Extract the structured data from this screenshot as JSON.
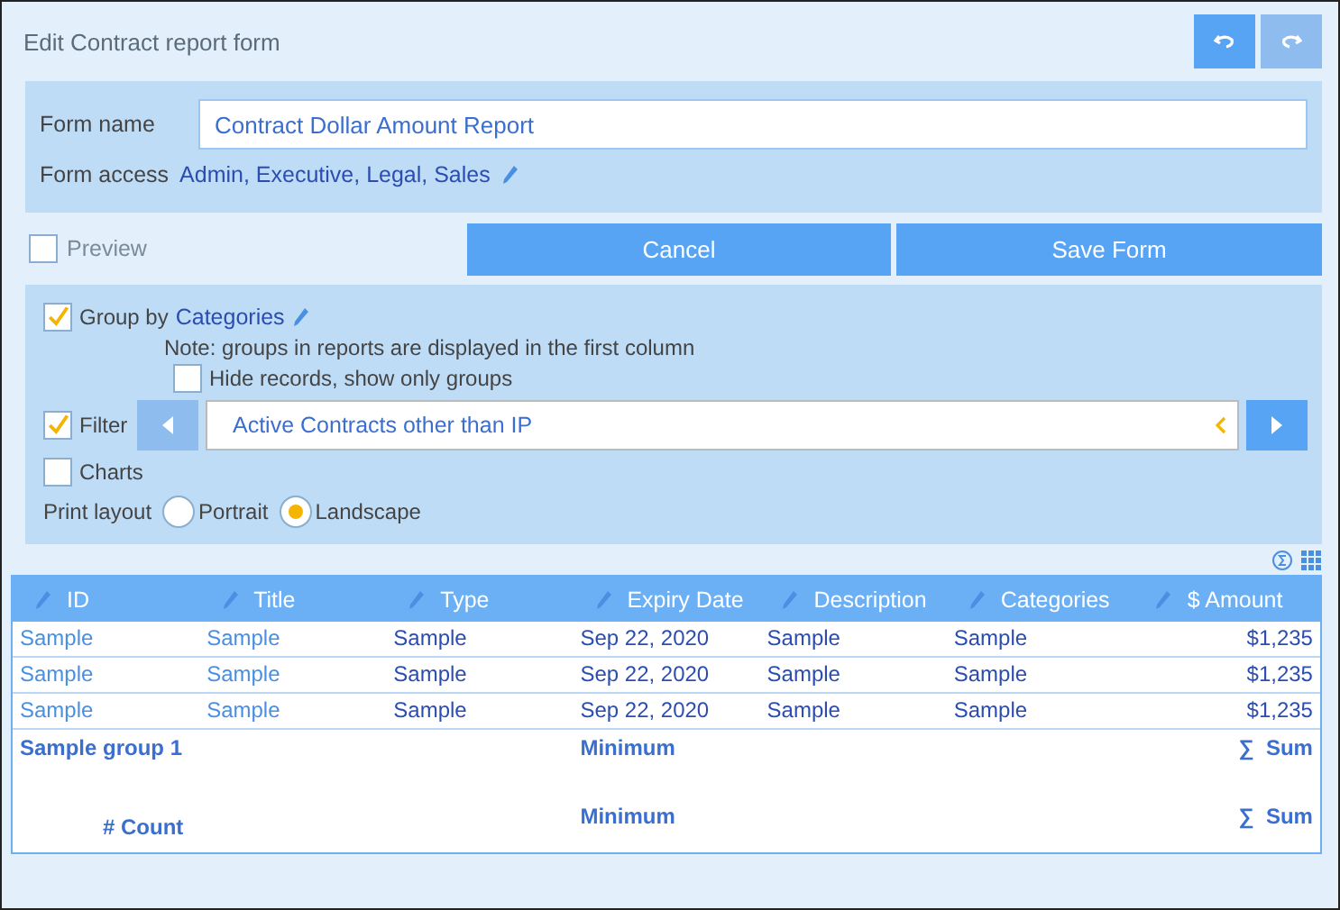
{
  "title": "Edit Contract report form",
  "toolbar": [
    {
      "kind": "undo",
      "disabled": false
    },
    {
      "kind": "redo",
      "disabled": true
    }
  ],
  "form_name": {
    "label": "Form name",
    "value": "Contract Dollar Amount Report"
  },
  "form_access": {
    "label": "Form access",
    "value": "Admin, Executive, Legal, Sales"
  },
  "preview": {
    "label": "Preview",
    "checked": false
  },
  "buttons": [
    "Cancel",
    "Save Form"
  ],
  "group_by": {
    "label": "Group by",
    "checked": true,
    "value": "Categories",
    "note": "Note: groups in reports are displayed in the first column",
    "hide_records": {
      "label": "Hide records, show only groups",
      "checked": false
    }
  },
  "filter": {
    "label": "Filter",
    "checked": true,
    "value": "Active Contracts other than IP",
    "prev_disabled": true,
    "next_disabled": false
  },
  "charts": {
    "label": "Charts",
    "checked": false
  },
  "print_layout": {
    "label": "Print layout",
    "options": [
      {
        "label": "Portrait",
        "selected": false
      },
      {
        "label": "Landscape",
        "selected": true
      }
    ]
  },
  "table": {
    "columns": [
      {
        "label": "ID",
        "kind": "link"
      },
      {
        "label": "Title",
        "kind": "link"
      },
      {
        "label": "Type",
        "kind": "text"
      },
      {
        "label": "Expiry Date",
        "kind": "text"
      },
      {
        "label": "Description",
        "kind": "text"
      },
      {
        "label": "Categories",
        "kind": "text"
      },
      {
        "label": "$ Amount",
        "kind": "amount"
      }
    ],
    "rows": [
      [
        "Sample",
        "Sample",
        "Sample",
        "Sep 22, 2020",
        "Sample",
        "Sample",
        "$1,235"
      ],
      [
        "Sample",
        "Sample",
        "Sample",
        "Sep 22, 2020",
        "Sample",
        "Sample",
        "$1,235"
      ],
      [
        "Sample",
        "Sample",
        "Sample",
        "Sep 22, 2020",
        "Sample",
        "Sample",
        "$1,235"
      ]
    ],
    "summary_rows": [
      [
        "Sample group 1",
        "",
        "",
        "Minimum",
        "",
        "",
        "∑  Sum"
      ],
      [
        "#  Count",
        "",
        "",
        "Minimum",
        "",
        "",
        "∑  Sum"
      ]
    ]
  }
}
